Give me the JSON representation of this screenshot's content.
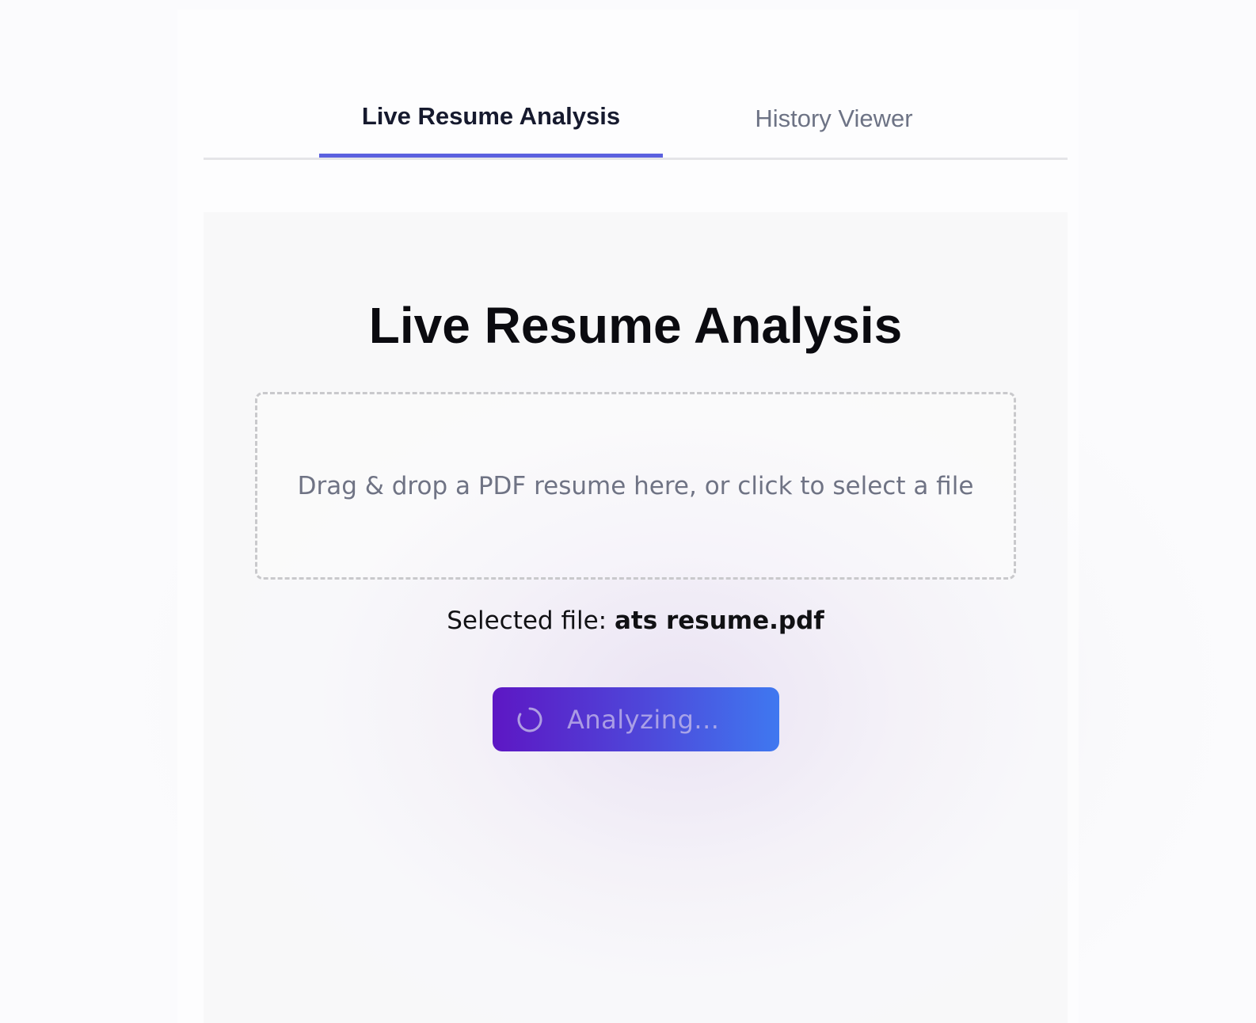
{
  "tabs": [
    {
      "label": "Live Resume Analysis",
      "active": true
    },
    {
      "label": "History Viewer",
      "active": false
    }
  ],
  "main": {
    "title": "Live Resume Analysis",
    "dropzone_text": "Drag & drop a PDF resume here, or click to select a file",
    "selected_file_label": "Selected file:",
    "selected_file_name": "ats resume.pdf",
    "analyze_button_label": "Analyzing..."
  },
  "colors": {
    "accent": "#5b61df",
    "button_gradient_start": "#5d17c4",
    "button_gradient_end": "#3f78f0"
  },
  "icons": {
    "loading": "spinner-icon"
  }
}
